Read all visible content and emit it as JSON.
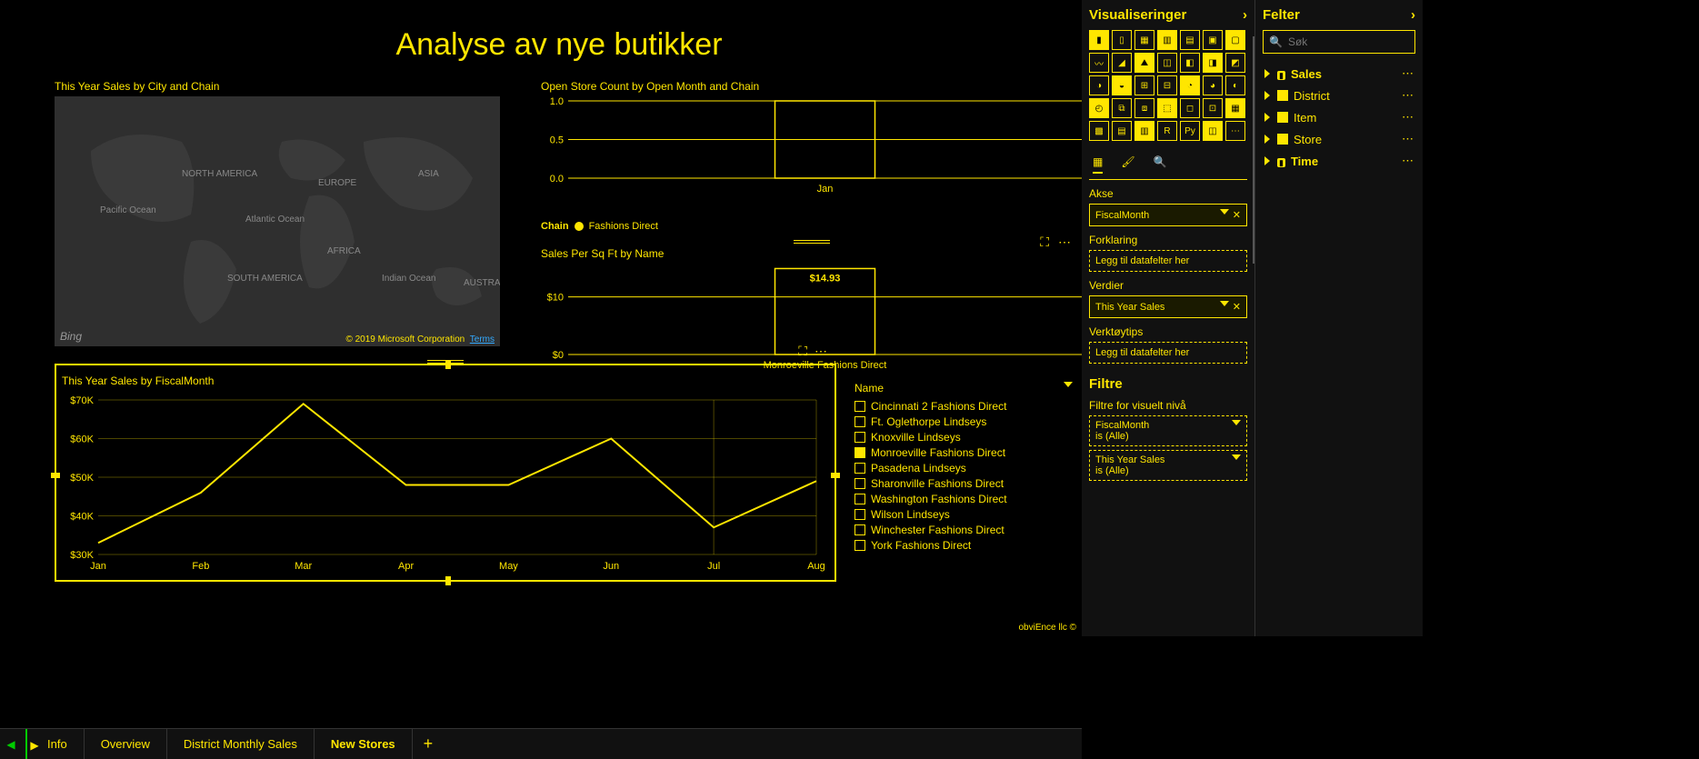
{
  "title": "Analyse av nye butikker",
  "map": {
    "title": "This Year Sales by City and Chain",
    "labels": [
      "NORTH AMERICA",
      "EUROPE",
      "ASIA",
      "AFRICA",
      "SOUTH AMERICA",
      "AUSTRALIA",
      "Pacific Ocean",
      "Atlantic Ocean",
      "Indian Ocean"
    ],
    "credit": "© 2019 Microsoft Corporation",
    "terms": "Terms",
    "bing": "Bing"
  },
  "chart_open": {
    "title": "Open Store Count by Open Month and Chain",
    "legend_label": "Chain",
    "legend_series": "Fashions Direct"
  },
  "chart_sqft": {
    "title": "Sales Per Sq Ft by Name",
    "value_label": "$14.93",
    "category": "Monroeville Fashions Direct"
  },
  "chart_line": {
    "title": "This Year Sales by FiscalMonth"
  },
  "legend": {
    "header": "Name",
    "items": [
      {
        "label": "Cincinnati 2 Fashions Direct",
        "selected": false
      },
      {
        "label": "Ft. Oglethorpe Lindseys",
        "selected": false
      },
      {
        "label": "Knoxville Lindseys",
        "selected": false
      },
      {
        "label": "Monroeville Fashions Direct",
        "selected": true
      },
      {
        "label": "Pasadena Lindseys",
        "selected": false
      },
      {
        "label": "Sharonville Fashions Direct",
        "selected": false
      },
      {
        "label": "Washington Fashions Direct",
        "selected": false
      },
      {
        "label": "Wilson Lindseys",
        "selected": false
      },
      {
        "label": "Winchester Fashions Direct",
        "selected": false
      },
      {
        "label": "York Fashions Direct",
        "selected": false
      }
    ]
  },
  "footer": "obviEnce llc ©",
  "tabs": [
    "Info",
    "Overview",
    "District Monthly Sales",
    "New Stores"
  ],
  "active_tab": 3,
  "vis_panel": {
    "title": "Visualiseringer",
    "akse_label": "Akse",
    "akse_value": "FiscalMonth",
    "forklaring_label": "Forklaring",
    "forklaring_ph": "Legg til datafelter her",
    "verdier_label": "Verdier",
    "verdier_value": "This Year Sales",
    "tooltips_label": "Verktøytips",
    "tooltips_ph": "Legg til datafelter her",
    "filtre": "Filtre",
    "filtre_sub": "Filtre for visuelt nivå",
    "filter1_name": "FiscalMonth",
    "filter1_val": "is (Alle)",
    "filter2_name": "This Year Sales",
    "filter2_val": "is (Alle)"
  },
  "fields_panel": {
    "title": "Felter",
    "search_ph": "Søk",
    "tables": [
      "Sales",
      "District",
      "Item",
      "Store",
      "Time"
    ]
  },
  "chart_data": [
    {
      "type": "bar",
      "id": "open_store_count",
      "title": "Open Store Count by Open Month and Chain",
      "categories": [
        "Jan"
      ],
      "series": [
        {
          "name": "Fashions Direct",
          "values": [
            1.0
          ]
        }
      ],
      "ylim": [
        0,
        1.0
      ],
      "yticks": [
        0.0,
        0.5,
        1.0
      ],
      "xlabel": "",
      "ylabel": ""
    },
    {
      "type": "bar",
      "id": "sales_per_sqft",
      "title": "Sales Per Sq Ft by Name",
      "categories": [
        "Monroeville Fashions Direct"
      ],
      "values": [
        14.93
      ],
      "ylim": [
        0,
        15
      ],
      "yticks": [
        0,
        10
      ],
      "ylabel_prefix": "$",
      "data_label": "$14.93"
    },
    {
      "type": "line",
      "id": "this_year_sales",
      "title": "This Year Sales by FiscalMonth",
      "categories": [
        "Jan",
        "Feb",
        "Mar",
        "Apr",
        "May",
        "Jun",
        "Jul",
        "Aug"
      ],
      "values": [
        33000,
        46000,
        69000,
        48000,
        48000,
        60000,
        37000,
        49000
      ],
      "ylim": [
        30000,
        70000
      ],
      "yticks_labels": [
        "$30K",
        "$40K",
        "$50K",
        "$60K",
        "$70K"
      ],
      "yticks": [
        30000,
        40000,
        50000,
        60000,
        70000
      ]
    }
  ]
}
